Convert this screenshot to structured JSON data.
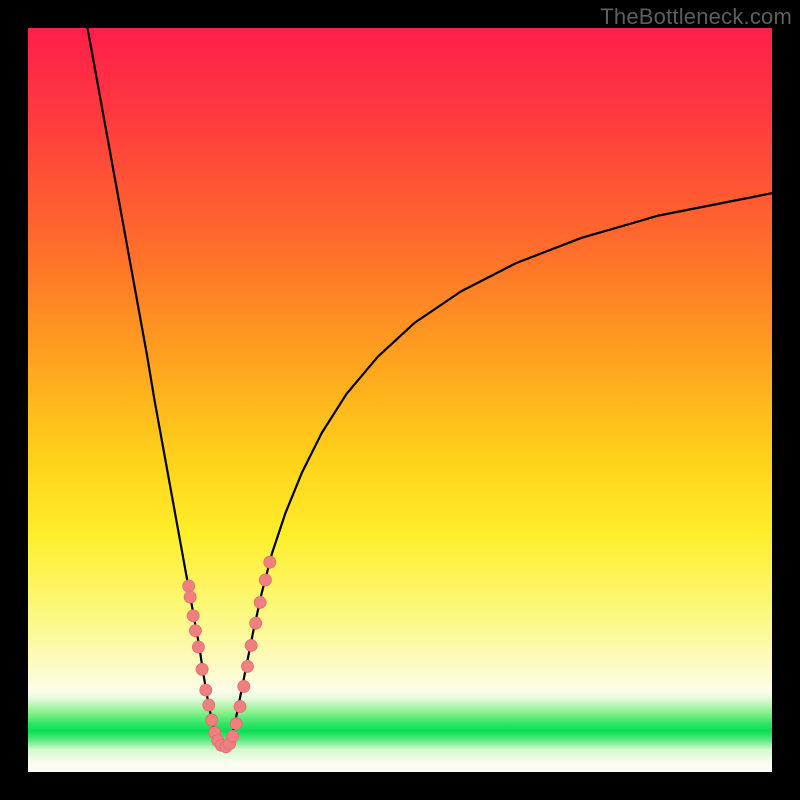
{
  "watermark": {
    "text": "TheBottleneck.com"
  },
  "colors": {
    "curve_stroke": "#000000",
    "marker_fill": "#f08080",
    "marker_stroke": "#e46a6a",
    "background_black": "#000000"
  },
  "chart_data": {
    "type": "line",
    "title": "",
    "xlabel": "",
    "ylabel": "",
    "xlim": [
      0,
      100
    ],
    "ylim": [
      0,
      100
    ],
    "grid": false,
    "legend": false,
    "series": [
      {
        "name": "left-curve",
        "x": [
          8,
          10,
          12,
          14,
          16,
          17,
          18,
          19,
          20,
          21,
          22,
          23,
          23.6,
          24.2,
          24.8,
          25.3
        ],
        "y": [
          100,
          89,
          78,
          67,
          56,
          50,
          44.5,
          39,
          33.5,
          28,
          22.5,
          17,
          13,
          9.5,
          6.5,
          4.2
        ]
      },
      {
        "name": "right-curve",
        "x": [
          27.3,
          27.9,
          28.6,
          29.4,
          30.3,
          31.4,
          32.8,
          34.6,
          36.8,
          39.5,
          42.8,
          47.0,
          52.0,
          58.2,
          65.6,
          74.4,
          84.8,
          97.0,
          100.0
        ],
        "y": [
          4.2,
          7.0,
          10.5,
          14.5,
          19.0,
          24.0,
          29.4,
          34.8,
          40.2,
          45.6,
          50.8,
          55.8,
          60.4,
          64.6,
          68.4,
          71.8,
          74.8,
          77.2,
          77.8
        ]
      }
    ],
    "valley_floor": {
      "x": [
        25.3,
        25.8,
        26.3,
        26.8,
        27.3
      ],
      "y": [
        4.2,
        3.5,
        3.3,
        3.5,
        4.2
      ]
    },
    "markers": [
      {
        "x": 21.6,
        "y": 25.0
      },
      {
        "x": 21.8,
        "y": 23.5
      },
      {
        "x": 22.2,
        "y": 21.0
      },
      {
        "x": 22.5,
        "y": 19.0
      },
      {
        "x": 22.9,
        "y": 16.8
      },
      {
        "x": 23.4,
        "y": 13.8
      },
      {
        "x": 23.9,
        "y": 11.0
      },
      {
        "x": 24.3,
        "y": 9.0
      },
      {
        "x": 24.7,
        "y": 7.0
      },
      {
        "x": 25.1,
        "y": 5.3
      },
      {
        "x": 25.5,
        "y": 4.2
      },
      {
        "x": 26.0,
        "y": 3.6
      },
      {
        "x": 26.6,
        "y": 3.4
      },
      {
        "x": 27.1,
        "y": 3.8
      },
      {
        "x": 27.5,
        "y": 4.8
      },
      {
        "x": 28.0,
        "y": 6.5
      },
      {
        "x": 28.5,
        "y": 8.8
      },
      {
        "x": 29.0,
        "y": 11.5
      },
      {
        "x": 29.5,
        "y": 14.2
      },
      {
        "x": 30.0,
        "y": 17.0
      },
      {
        "x": 30.6,
        "y": 20.0
      },
      {
        "x": 31.2,
        "y": 22.8
      },
      {
        "x": 31.9,
        "y": 25.8
      },
      {
        "x": 32.5,
        "y": 28.2
      }
    ],
    "marker_radius": 6
  }
}
